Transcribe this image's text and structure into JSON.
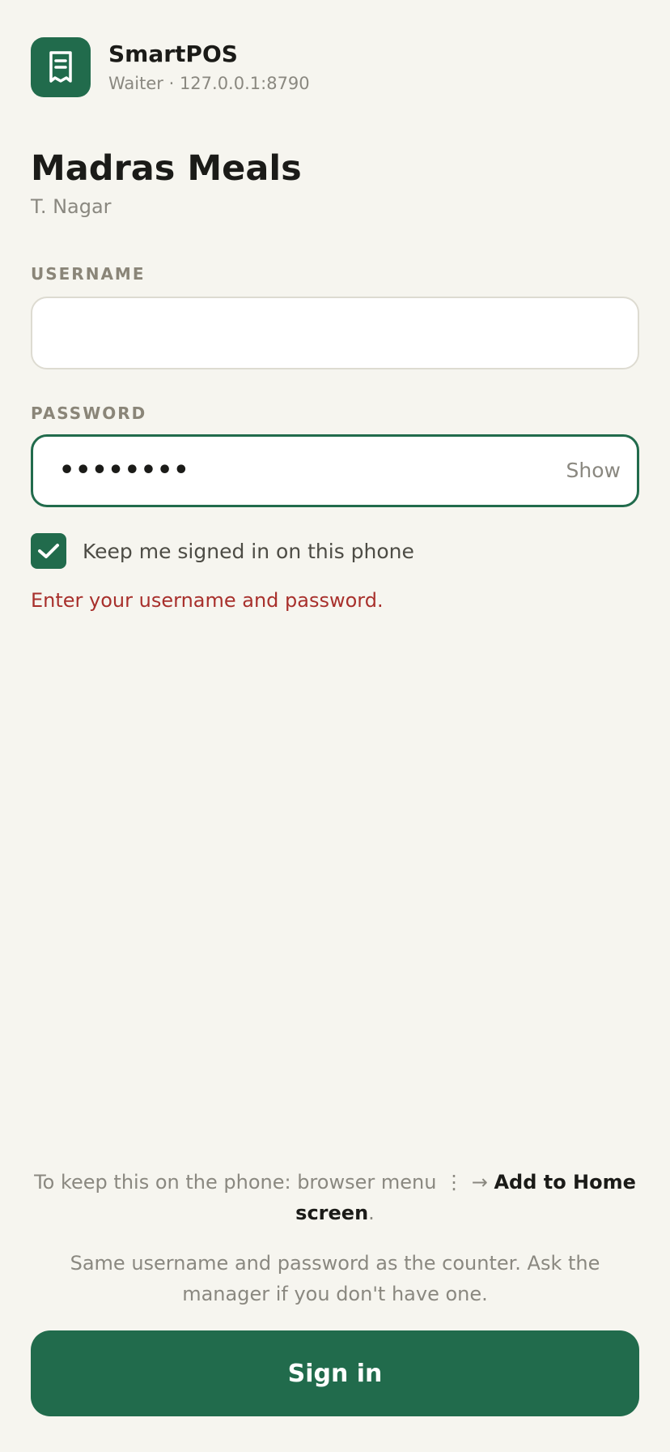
{
  "app": {
    "name": "SmartPOS",
    "subtitle": "Waiter · 127.0.0.1:8790",
    "icon": "receipt-icon",
    "accent_color": "#216b4c"
  },
  "restaurant": {
    "name": "Madras Meals",
    "branch": "T. Nagar"
  },
  "form": {
    "username": {
      "label": "USERNAME",
      "value": "",
      "placeholder": ""
    },
    "password": {
      "label": "PASSWORD",
      "masked_value": "••••••••",
      "toggle_label": "Show"
    },
    "remember": {
      "label": "Keep me signed in on this phone",
      "checked": true
    },
    "error": "Enter your username and password.",
    "error_color": "#a8302c"
  },
  "install_hint": {
    "prefix": "To keep this on the phone: browser menu",
    "menu_glyph": "⋮",
    "arrow": "→",
    "action": "Add to Home screen",
    "suffix": "."
  },
  "help_text": "Same username and password as the counter. Ask the manager if you don't have one.",
  "submit": {
    "label": "Sign in"
  }
}
